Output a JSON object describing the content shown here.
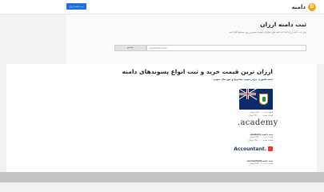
{
  "header": {
    "logo_text": "دامنه",
    "logo_glyph": "D",
    "button_label": "ثبت دامنه ارزان"
  },
  "hero": {
    "title": "ثبت دامنه ارزان",
    "description": "برای ثبت دامنه ارزان ابتدا نام دامنه مورد نظرتان بنویسید سپس بر روی جستجو کلیک کنید",
    "search_placeholder": "yourdomain.com",
    "search_button": "جستجو"
  },
  "section": {
    "title": "ارزان ترین قیمت خرید و ثبت انواع پسوندهای دامنه"
  },
  "items": [
    {
      "title": "دامنه کشوری جزایر جنوبی ساندویچ و جورجیای جنوبی",
      "line1": "قیمت ثبت: ۶۷۶،۰۰۰ تومان",
      "line2": "قیمت تمدید: ۶۷۶،۰۰۰ تومان"
    },
    {
      "logo": ".academy",
      "title": "ثبت دامنه academy.",
      "line1": "قیمت ثبت: ۶۳۸،۰۰۰ تومان",
      "line2": "قیمت تمدید: ۶۳۸،۰۰۰ تومان"
    },
    {
      "logo": "Accountant.",
      "title": "ثبت دامنه accountant.",
      "line1": "قیمت ثبت: ۴۸۷،۰۰۰ تومان",
      "line2": ""
    }
  ],
  "colors": {
    "accent": "#1e6fd9",
    "logo": "#f4a11c"
  }
}
